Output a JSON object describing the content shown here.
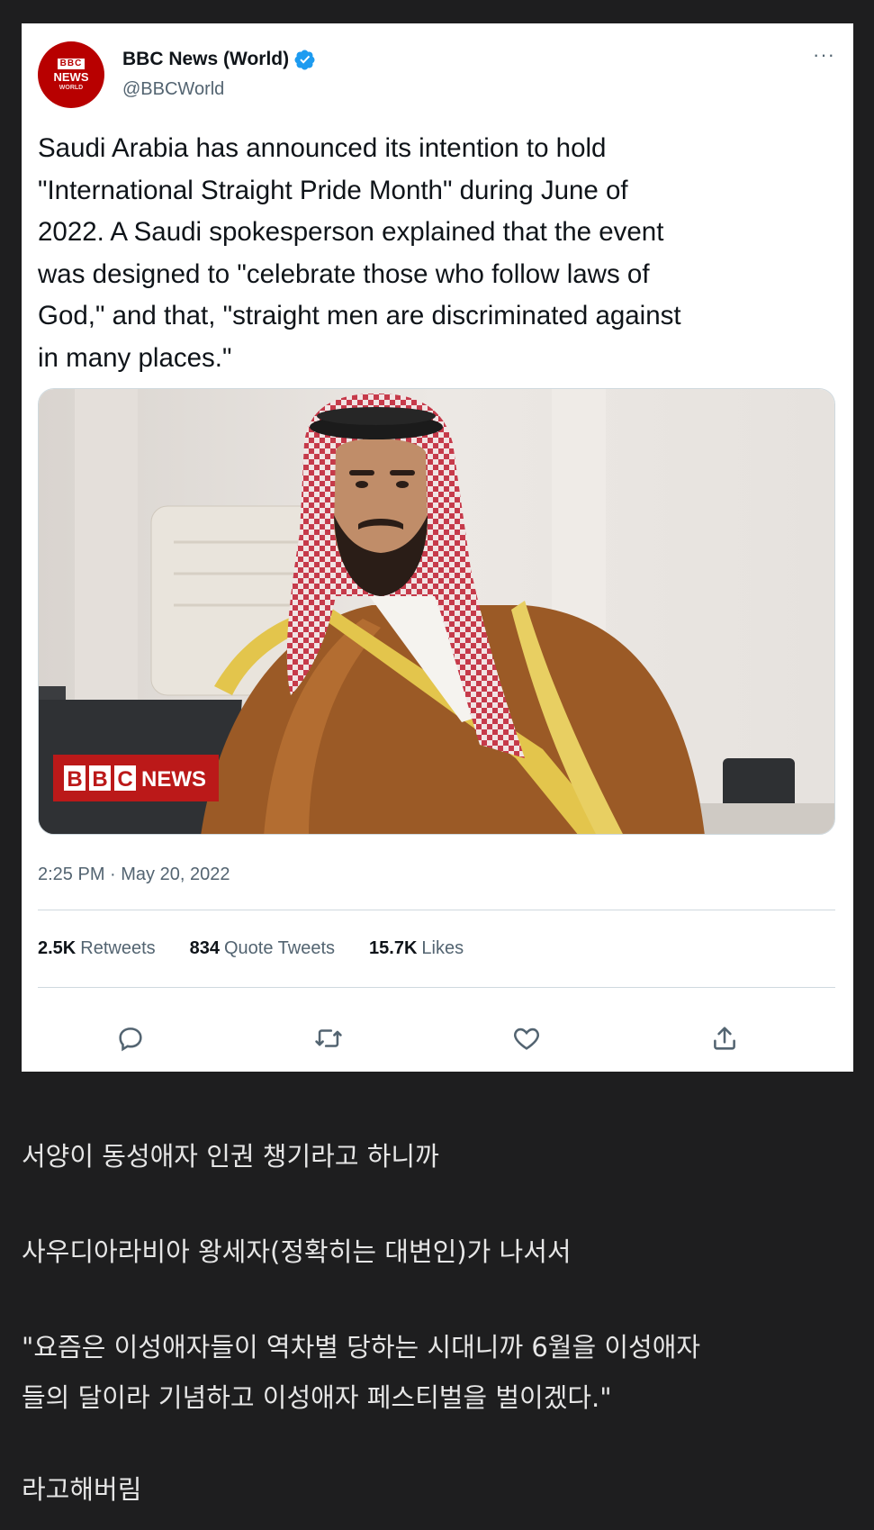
{
  "tweet": {
    "avatar": {
      "line1": "BBC",
      "line2": "NEWS",
      "line3": "WORLD"
    },
    "author_name": "BBC News (World)",
    "author_handle": "@BBCWorld",
    "more_label": "···",
    "text": "Saudi Arabia has announced its intention to hold\n\"International Straight Pride Month\" during June of\n2022. A Saudi spokesperson explained that the event\nwas designed to \"celebrate those who follow laws of\nGod,\" and that, \"straight men are discriminated against\nin many places.\"",
    "media": {
      "watermark_blocks": [
        "B",
        "B",
        "C"
      ],
      "watermark_word": "NEWS"
    },
    "timestamp": "2:25 PM · May 20, 2022",
    "stats": {
      "retweets_count": "2.5K",
      "retweets_label": "Retweets",
      "quotes_count": "834",
      "quotes_label": "Quote Tweets",
      "likes_count": "15.7K",
      "likes_label": "Likes"
    },
    "icons": [
      "reply-icon",
      "retweet-icon",
      "like-icon",
      "share-icon"
    ],
    "verified_color": "#1d9bf0"
  },
  "caption": {
    "line1": "서양이 동성애자 인권 챙기라고 하니까",
    "line2": "사우디아라비아 왕세자(정확히는 대변인)가 나서서",
    "line3": "\"요즘은 이성애자들이 역차별 당하는 시대니까 6월을 이성애자",
    "line4": "들의 달이라 기념하고 이성애자 페스티벌을 벌이겠다.\"",
    "line5": "라고해버림"
  }
}
